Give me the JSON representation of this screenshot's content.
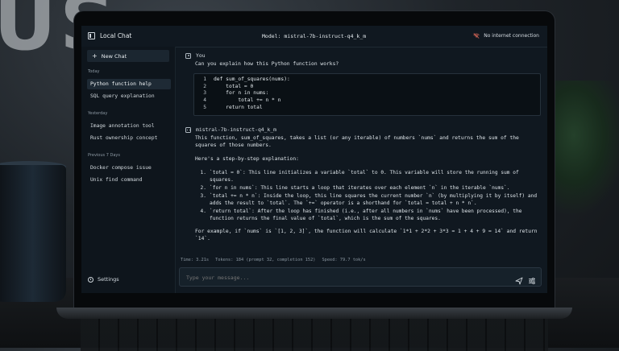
{
  "background": {
    "wall_letters": "US"
  },
  "app": {
    "title": "Local Chat",
    "model_label": "Model: mistral-7b-instruct-q4_k_m",
    "network_status": "No internet connection"
  },
  "sidebar": {
    "new_chat": "New Chat",
    "sections": [
      {
        "label": "Today",
        "items": [
          {
            "label": "Python function help",
            "active": true
          },
          {
            "label": "SQL query explanation",
            "active": false
          }
        ]
      },
      {
        "label": "Yesterday",
        "items": [
          {
            "label": "Image annotation tool",
            "active": false
          },
          {
            "label": "Rust ownership concept",
            "active": false
          }
        ]
      },
      {
        "label": "Previous 7 Days",
        "items": [
          {
            "label": "Docker compose issue",
            "active": false
          },
          {
            "label": "Unix find command",
            "active": false
          }
        ]
      }
    ],
    "settings": "Settings"
  },
  "conversation": {
    "user": {
      "name": "You",
      "message": "Can you explain how this Python function works?",
      "code": [
        {
          "n": "1",
          "text": "def sum_of_squares(nums):"
        },
        {
          "n": "2",
          "text": "    total = 0"
        },
        {
          "n": "3",
          "text": "    for n in nums:"
        },
        {
          "n": "4",
          "text": "        total += n * n"
        },
        {
          "n": "5",
          "text": "    return total"
        }
      ]
    },
    "assistant": {
      "name": "mistral-7b-instruct-q4_k_m",
      "intro": "This function, sum_of_squares, takes a list (or any iterable) of numbers `nums` and returns the sum of the squares of those numbers.",
      "steps_heading": "Here's a step-by-step explanation:",
      "steps": [
        {
          "num": "1.",
          "text": "`total = 0`: This line initializes a variable `total` to 0. This variable will store the running sum of squares."
        },
        {
          "num": "2.",
          "text": "`for n in nums`: This line starts a loop that iterates over each element `n` in the iterable `nums`."
        },
        {
          "num": "3.",
          "text": "`total += n * n`: Inside the loop, this line squares the current number `n` (by multiplying it by itself) and adds the result to `total`. The `+=` operator is a shorthand for `total = total + n * n`."
        },
        {
          "num": "4.",
          "text": "`return total`: After the loop has finished (i.e., after all numbers in `nums` have been processed), the function returns the final value of `total`, which is the sum of the squares."
        }
      ],
      "example": "For example, if `nums` is `[1, 2, 3]`, the function will calculate `1*1 + 2*2 + 3*3 = 1 + 4 + 9 = 14` and return `14`."
    }
  },
  "stats": {
    "time": "Time: 3.21s",
    "tokens": "Tokens: 184 (prompt 32, completion 152)",
    "speed": "Speed: 79.7 tok/s"
  },
  "composer": {
    "placeholder": "Type your message..."
  },
  "colors": {
    "screen_bg": "#101820",
    "sidebar_bg": "#0e151c",
    "active_item": "#1e2a35",
    "text": "#dce3e8"
  }
}
